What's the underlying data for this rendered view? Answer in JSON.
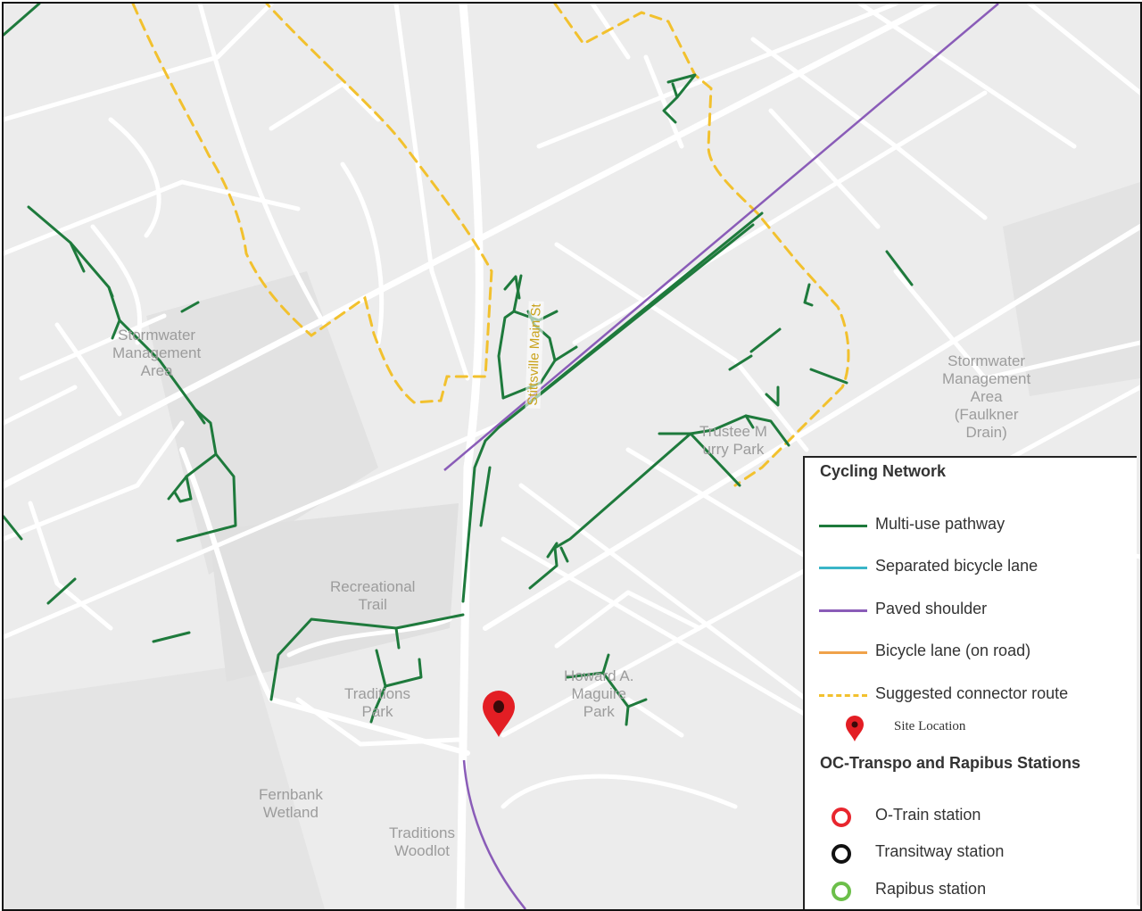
{
  "map": {
    "background_color": "#ececec",
    "road_color": "#ffffff",
    "street_label": "Stittsville Main St",
    "place_labels": [
      {
        "id": "stormwater-west",
        "text": [
          "Stormwater",
          "Management",
          "Area"
        ]
      },
      {
        "id": "stormwater-east",
        "text": [
          "Stormwater",
          "Management",
          "Area",
          "(Faulkner",
          "Drain)"
        ]
      },
      {
        "id": "trustee-park",
        "text": [
          "Trustee M",
          "urry Park"
        ]
      },
      {
        "id": "recreational-trail",
        "text": [
          "Recreational",
          "Trail"
        ]
      },
      {
        "id": "traditions-park",
        "text": [
          "Traditions",
          "Park"
        ]
      },
      {
        "id": "howard-park",
        "text": [
          "Howard A.",
          "Maguire",
          "Park"
        ]
      },
      {
        "id": "fernbank-wetland",
        "text": [
          "Fernbank",
          "Wetland"
        ]
      },
      {
        "id": "traditions-woodlot",
        "text": [
          "Traditions",
          "Woodlot"
        ]
      }
    ],
    "site_marker_icon": "map-pin-icon"
  },
  "legend": {
    "cycling_title": "Cycling Network",
    "items": [
      {
        "label": "Multi-use pathway",
        "color": "#1e7a3c",
        "style": "solid"
      },
      {
        "label": "Separated bicycle lane",
        "color": "#3ab5c8",
        "style": "solid"
      },
      {
        "label": "Paved shoulder",
        "color": "#8a5cb8",
        "style": "solid"
      },
      {
        "label": "Bicycle lane (on road)",
        "color": "#f0a24a",
        "style": "solid"
      },
      {
        "label": "Suggested connector route",
        "color": "#f2c12e",
        "style": "dashed"
      }
    ],
    "site_label": "Site Location",
    "transit_title": "OC-Transpo and Rapibus Stations",
    "stations": [
      {
        "label": "O-Train station",
        "color": "#e8262e"
      },
      {
        "label": "Transitway station",
        "color": "#111111"
      },
      {
        "label": "Rapibus station",
        "color": "#6cbf4a"
      }
    ]
  },
  "colors": {
    "multi_use": "#1e7a3c",
    "paved_shoulder": "#8a5cb8",
    "connector": "#f2c12e",
    "site_pin": "#e31e24"
  }
}
